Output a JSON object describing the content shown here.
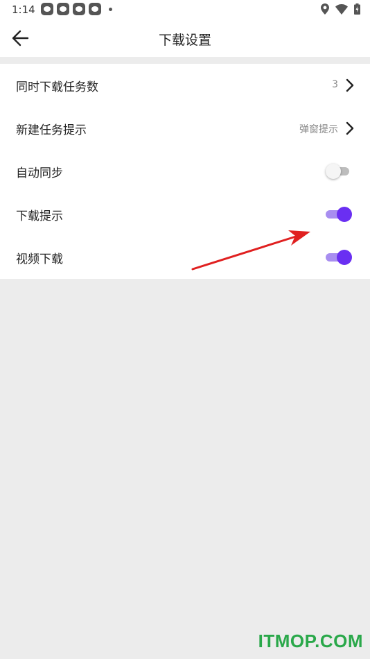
{
  "status_bar": {
    "time": "1:14",
    "notification_icons": [
      "app-notification-icon",
      "app-notification-icon",
      "app-notification-icon",
      "app-notification-icon"
    ],
    "system_icons": [
      "location-icon",
      "wifi-icon",
      "battery-icon"
    ]
  },
  "app_bar": {
    "back_icon": "arrow-left-icon",
    "title": "下载设置"
  },
  "settings": [
    {
      "label": "同时下载任务数",
      "value": "3",
      "control": "chevron"
    },
    {
      "label": "新建任务提示",
      "value": "弹窗提示",
      "control": "chevron"
    },
    {
      "label": "自动同步",
      "control": "toggle",
      "on": false
    },
    {
      "label": "下载提示",
      "control": "toggle",
      "on": true
    },
    {
      "label": "视频下载",
      "control": "toggle",
      "on": true
    }
  ],
  "colors": {
    "accent": "#6a2ff2",
    "accent_track": "#a88ef0",
    "annotation_arrow": "#e02020",
    "watermark": "#2aa84a",
    "page_background": "#ececec"
  },
  "watermark": "ITMOP.COM"
}
